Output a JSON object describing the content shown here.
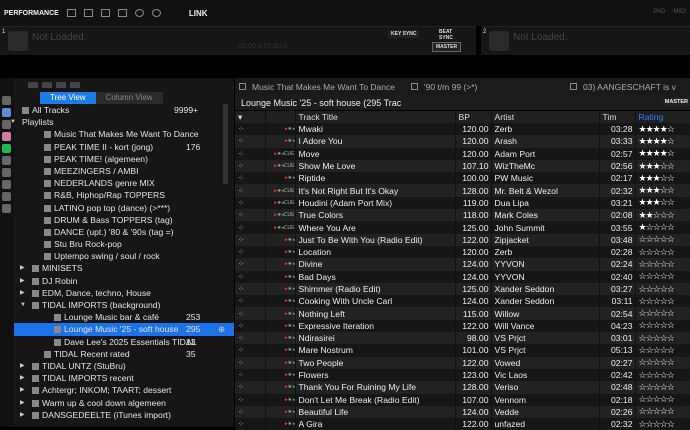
{
  "topbar": {
    "mode": "PERFORMANCE",
    "link": "LINK",
    "right_items": [
      "PAD",
      "MIDI"
    ]
  },
  "decks": [
    {
      "number": "1",
      "status": "Not Loaded.",
      "time": "-00:00.0  00:00.0",
      "key_sync": "KEY SYNC",
      "beat_sync": "BEAT SYNC",
      "master": "MASTER"
    },
    {
      "number": "2",
      "status": "Not Loaded."
    }
  ],
  "browser": {
    "tabs": {
      "tree": "Tree View",
      "column": "Column View"
    },
    "tree": [
      {
        "label": "All Tracks",
        "count": "9999+",
        "level": 0,
        "icon": "music-note-icon"
      },
      {
        "label": "Playlists",
        "level": 0,
        "arrow": "▼"
      },
      {
        "label": "Music That Makes Me Want To Dance",
        "level": 2,
        "icon": "intelligent-playlist-icon"
      },
      {
        "label": "PEAK TIME II - kort (jong)",
        "count": "176",
        "level": 2,
        "icon": "playlist-icon"
      },
      {
        "label": "PEAK TIME! (algemeen)",
        "level": 2,
        "icon": "intelligent-playlist-icon"
      },
      {
        "label": "MEEZINGERS / AMBI",
        "level": 2,
        "icon": "intelligent-playlist-icon"
      },
      {
        "label": "NEDERLANDS genre MIX",
        "level": 2,
        "icon": "intelligent-playlist-icon"
      },
      {
        "label": "R&B, Hiphop/Rap TOPPERS",
        "level": 2,
        "icon": "intelligent-playlist-icon"
      },
      {
        "label": "LATINO pop top (dance) (>***)",
        "level": 2,
        "icon": "intelligent-playlist-icon"
      },
      {
        "label": "DRUM & Bass TOPPERS (tag)",
        "level": 2,
        "icon": "intelligent-playlist-icon"
      },
      {
        "label": "DANCE (upt.) '80 & '90s (tag =)",
        "level": 2,
        "icon": "intelligent-playlist-icon"
      },
      {
        "label": "Stu Bru Rock-pop",
        "level": 2,
        "icon": "intelligent-playlist-icon"
      },
      {
        "label": "Uptempo swing / soul / rock",
        "level": 2,
        "icon": "intelligent-playlist-icon"
      },
      {
        "label": "MINISETS",
        "level": 1,
        "arrow": "▶",
        "icon": "folder-icon"
      },
      {
        "label": "DJ Robin",
        "level": 1,
        "arrow": "▶",
        "icon": "folder-icon"
      },
      {
        "label": "EDM, Dance, techno, House",
        "level": 1,
        "arrow": "▶",
        "icon": "folder-icon"
      },
      {
        "label": "TIDAL IMPORTS (background)",
        "level": 1,
        "arrow": "▼",
        "icon": "folder-icon"
      },
      {
        "label": "Lounge Music bar & café",
        "count": "253",
        "level": 3,
        "icon": "playlist-icon"
      },
      {
        "label": "Lounge Music '25 - soft house",
        "count": "295",
        "level": 3,
        "icon": "playlist-icon",
        "selected": true
      },
      {
        "label": "Dave Lee's 2025 Essentials TIDAL",
        "count": "13",
        "level": 3,
        "icon": "playlist-icon"
      },
      {
        "label": "TIDAL Recent rated",
        "count": "35",
        "level": 2,
        "icon": "playlist-icon"
      },
      {
        "label": "TIDAL UNTZ (StuBru)",
        "level": 1,
        "arrow": "▶",
        "icon": "folder-icon"
      },
      {
        "label": "TIDAL IMPORTS recent",
        "level": 1,
        "arrow": "▶",
        "icon": "folder-icon"
      },
      {
        "label": "Achtergr; INKOM; TAART; dessert",
        "level": 1,
        "arrow": "▶",
        "icon": "folder-icon"
      },
      {
        "label": "Warm up & cool down algemeen",
        "level": 1,
        "arrow": "▶",
        "icon": "folder-icon"
      },
      {
        "label": "DANSGEDEELTE (iTunes import)",
        "level": 1,
        "arrow": "▶",
        "icon": "folder-icon"
      }
    ]
  },
  "pane_tabs": [
    "Music That Makes Me Want To Dance",
    "'90 t/m 99 (>*)",
    "03) AANGESCHAFT is v"
  ],
  "list": {
    "title": "Lounge Music '25 - soft house  (295 Trac",
    "master": "MASTER",
    "columns": [
      "Track Title",
      "BP",
      "Artist",
      "Tim",
      "Rating"
    ],
    "tracks": [
      {
        "title": "Mwaki",
        "bpm": "120.00",
        "artist": "Zerb",
        "time": "03:28",
        "rating": 4,
        "cue": false
      },
      {
        "title": "I Adore You",
        "bpm": "120.00",
        "artist": "Arash",
        "time": "03:33",
        "rating": 4,
        "cue": false
      },
      {
        "title": "Move",
        "bpm": "120.00",
        "artist": "Adam Port",
        "time": "02:57",
        "rating": 4,
        "cue": true
      },
      {
        "title": "Show Me Love",
        "bpm": "107.10",
        "artist": "WizTheMc",
        "time": "02:56",
        "rating": 3,
        "cue": true
      },
      {
        "title": "Riptide",
        "bpm": "100.00",
        "artist": "PW Music",
        "time": "02:17",
        "rating": 3,
        "cue": false
      },
      {
        "title": "It's Not Right But It's Okay",
        "bpm": "128.00",
        "artist": "Mr. Belt & Wezol",
        "time": "02:32",
        "rating": 3,
        "cue": true
      },
      {
        "title": "Houdini (Adam Port Mix)",
        "bpm": "119.00",
        "artist": "Dua Lipa",
        "time": "03:21",
        "rating": 3,
        "cue": true
      },
      {
        "title": "True Colors",
        "bpm": "118.00",
        "artist": "Mark Coles",
        "time": "02:08",
        "rating": 2,
        "cue": true
      },
      {
        "title": "Where You Are",
        "bpm": "125.00",
        "artist": "John Summit",
        "time": "03:55",
        "rating": 1,
        "cue": true
      },
      {
        "title": "Just To Be With You (Radio Edit)",
        "bpm": "122.00",
        "artist": "Zipjacket",
        "time": "03:48",
        "rating": 0,
        "cue": false
      },
      {
        "title": "Location",
        "bpm": "120.00",
        "artist": "Zerb",
        "time": "02:28",
        "rating": 0,
        "cue": false
      },
      {
        "title": "Divine",
        "bpm": "124.00",
        "artist": "YYVON",
        "time": "02:24",
        "rating": 0,
        "cue": false
      },
      {
        "title": "Bad Days",
        "bpm": "124.00",
        "artist": "YYVON",
        "time": "02:40",
        "rating": 0,
        "cue": false
      },
      {
        "title": "Shimmer (Radio Edit)",
        "bpm": "125.00",
        "artist": "Xander Seddon",
        "time": "03:27",
        "rating": 0,
        "cue": false
      },
      {
        "title": "Cooking With Uncle Carl",
        "bpm": "124.00",
        "artist": "Xander Seddon",
        "time": "03:11",
        "rating": 0,
        "cue": false
      },
      {
        "title": "Nothing Left",
        "bpm": "115.00",
        "artist": "Willow",
        "time": "02:54",
        "rating": 0,
        "cue": false
      },
      {
        "title": "Expressive Iteration",
        "bpm": "122.00",
        "artist": "Will Vance",
        "time": "04:23",
        "rating": 0,
        "cue": false
      },
      {
        "title": "Ndirasirei",
        "bpm": "98.00",
        "artist": "VS Prjct",
        "time": "03:01",
        "rating": 0,
        "cue": false
      },
      {
        "title": "Mare Nostrum",
        "bpm": "101.00",
        "artist": "VS Prjct",
        "time": "05:13",
        "rating": 0,
        "cue": false
      },
      {
        "title": "Two People",
        "bpm": "122.00",
        "artist": "Vowed",
        "time": "02:27",
        "rating": 0,
        "cue": false
      },
      {
        "title": "Flowers",
        "bpm": "123.00",
        "artist": "Vic Laos",
        "time": "02:42",
        "rating": 0,
        "cue": false
      },
      {
        "title": "Thank You For Ruining My Life",
        "bpm": "128.00",
        "artist": "Veriso",
        "time": "02:48",
        "rating": 0,
        "cue": false
      },
      {
        "title": "Don't Let Me Break (Radio Edit)",
        "bpm": "107.00",
        "artist": "Vennom",
        "time": "02:18",
        "rating": 0,
        "cue": false
      },
      {
        "title": "Beautiful Life",
        "bpm": "124.00",
        "artist": "Vedde",
        "time": "02:26",
        "rating": 0,
        "cue": false
      },
      {
        "title": "A Gira",
        "bpm": "122.00",
        "artist": "unfazed",
        "time": "02:32",
        "rating": 0,
        "cue": false
      }
    ]
  },
  "colors": {
    "accent": "#1e7ce6",
    "selected": "#1a73e8",
    "rating_header": "#2a7fff"
  }
}
